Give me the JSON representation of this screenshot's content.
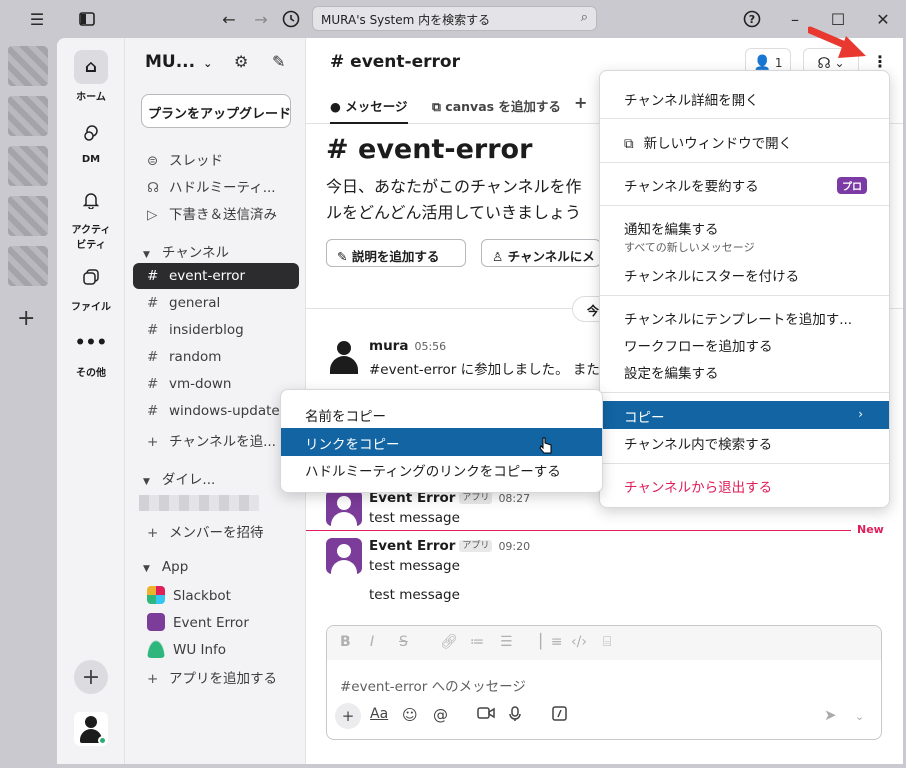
{
  "titlebar": {
    "search_placeholder": "MURA's System 内を検索する"
  },
  "nav": {
    "home": "ホーム",
    "dm": "DM",
    "activity_line1": "アクティ",
    "activity_line2": "ビティ",
    "files": "ファイル",
    "more": "その他"
  },
  "sidebar": {
    "workspace": "MU...",
    "upgrade": "プランをアップグレード",
    "threads": "スレッド",
    "huddles": "ハドルミーティ...",
    "drafts": "下書き＆送信済み",
    "channels_section": "チャンネル",
    "channels": [
      "event-error",
      "general",
      "insiderblog",
      "random",
      "vm-down",
      "windows-update"
    ],
    "add_channel": "チャンネルを追...",
    "dm_section": "ダイレ...",
    "invite": "メンバーを招待",
    "apps_section": "App",
    "apps": [
      "Slackbot",
      "Event Error",
      "WU Info"
    ],
    "add_app": "アプリを追加する"
  },
  "channel": {
    "name": "# event-error",
    "member_count": "1",
    "tab_messages": "メッセージ",
    "tab_canvas": "canvas を追加する",
    "big_title": "# event-error",
    "intro_line1": "今日、あなたがこのチャンネルを作",
    "intro_line2": "ルをどんどん活用していきましょう",
    "btn_add_desc": "説明を追加する",
    "btn_channel": "チャンネルにメ",
    "date_pill": "今",
    "new_label": "New",
    "composer_placeholder": "#event-error へのメッセージ"
  },
  "messages": [
    {
      "name": "mura",
      "time": "05:56",
      "text": "#event-error に参加しました。 また"
    },
    {
      "name": "Event Error",
      "badge": "アプリ",
      "time": "08:27",
      "text": "test message"
    },
    {
      "name": "Event Error",
      "badge": "アプリ",
      "time": "09:20",
      "text": "test message",
      "text2": "test message"
    }
  ],
  "channel_menu": {
    "items": [
      "チャンネル詳細を開く",
      "新しいウィンドウで開く",
      "チャンネルを要約する",
      "通知を編集する",
      "すべての新しいメッセージ",
      "チャンネルにスターを付ける",
      "チャンネルにテンプレートを追加す...",
      "ワークフローを追加する",
      "設定を編集する",
      "コピー",
      "チャンネル内で検索する",
      "チャンネルから退出する"
    ],
    "pro_badge": "プロ"
  },
  "copy_submenu": {
    "items": [
      "名前をコピー",
      "リンクをコピー",
      "ハドルミーティングのリンクをコピーする"
    ]
  },
  "colors": {
    "accent": "#1264a3",
    "danger": "#e01e5a",
    "sidebar_active": "#2c2c2f",
    "pro": "#7c3aa4"
  }
}
